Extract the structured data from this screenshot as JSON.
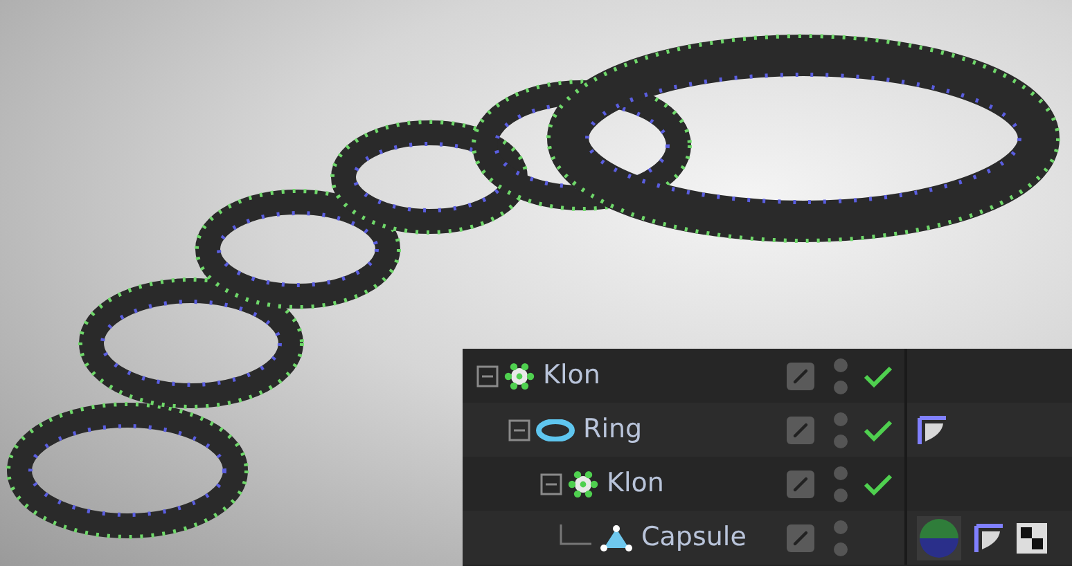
{
  "object_manager": {
    "objects": [
      {
        "name": "Klon",
        "kind": "cloner",
        "expanded": true,
        "enabled": true,
        "children": [
          {
            "name": "Ring",
            "kind": "torus",
            "expanded": true,
            "enabled": true,
            "tags": [
              {
                "kind": "phong"
              }
            ],
            "children": [
              {
                "name": "Klon",
                "kind": "cloner",
                "expanded": true,
                "enabled": true,
                "children": [
                  {
                    "name": "Capsule",
                    "kind": "capsule",
                    "tags": [
                      {
                        "kind": "material"
                      },
                      {
                        "kind": "phong"
                      },
                      {
                        "kind": "texture"
                      }
                    ]
                  }
                ]
              }
            ]
          }
        ]
      }
    ]
  }
}
